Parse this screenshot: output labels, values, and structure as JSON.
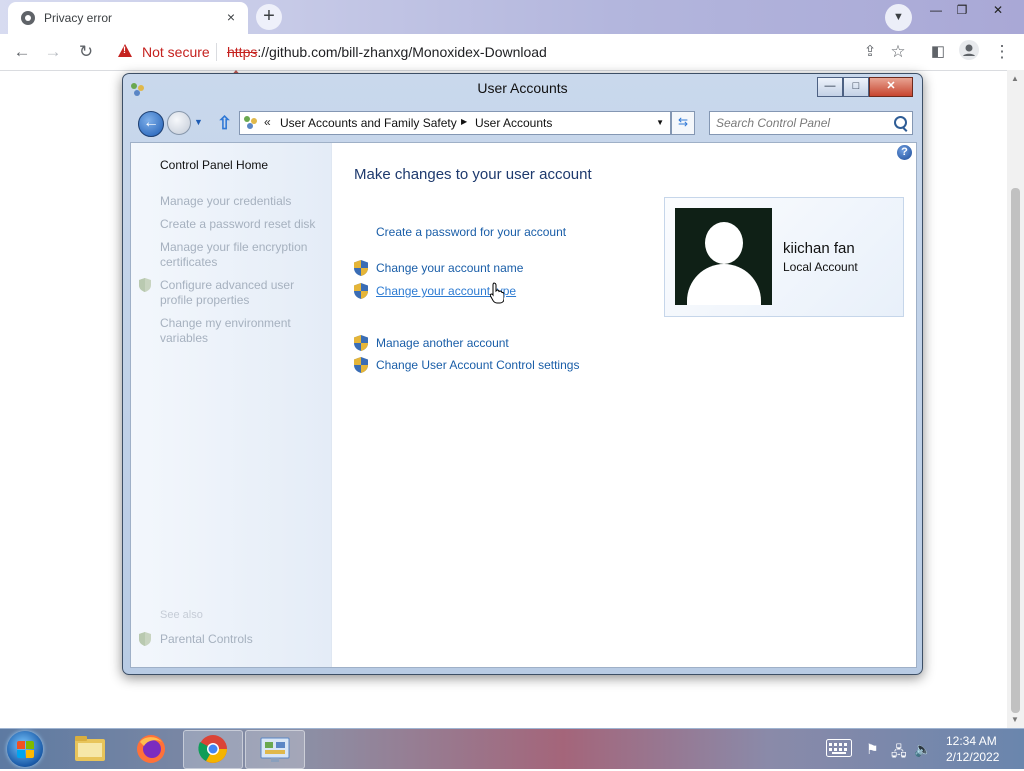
{
  "browser": {
    "tab_title": "Privacy error",
    "tab_close": "×",
    "new_tab": "+",
    "security_label": "Not secure",
    "url_scheme": "https",
    "url_rest": "://github.com/bill-zhanxg/Monoxidex-Download",
    "window_controls": [
      "—",
      "❐",
      "✕"
    ]
  },
  "window": {
    "title": "User Accounts",
    "breadcrumb_prefix": "«",
    "breadcrumb": [
      "User Accounts and Family Safety",
      "User Accounts"
    ],
    "search_placeholder": "Search Control Panel",
    "help_glyph": "?",
    "caption_buttons": {
      "minimize": "—",
      "maximize": "□",
      "close": "✕"
    }
  },
  "left_pane": {
    "home": "Control Panel Home",
    "items": [
      "Manage your credentials",
      "Create a password reset disk",
      "Manage your file encryption certificates",
      "Configure advanced user profile properties",
      "Change my environment variables"
    ],
    "see_also_label": "See also",
    "see_also_items": [
      "Parental Controls"
    ]
  },
  "main": {
    "heading": "Make changes to your user account",
    "tasks": [
      "Create a password for your account",
      "Change your account name",
      "Change your account type",
      "Manage another account",
      "Change User Account Control settings"
    ]
  },
  "account": {
    "name": "kiichan fan",
    "type": "Local Account"
  },
  "taskbar": {
    "apps": [
      "file-explorer",
      "firefox",
      "chrome",
      "control-panel"
    ],
    "clock_time": "12:34 AM",
    "clock_date": "2/12/2022"
  },
  "colors": {
    "link": "#1a5ea8",
    "disabled": "#a6b1bf",
    "heading": "#1e3a6e",
    "not_secure": "#c5221f"
  }
}
